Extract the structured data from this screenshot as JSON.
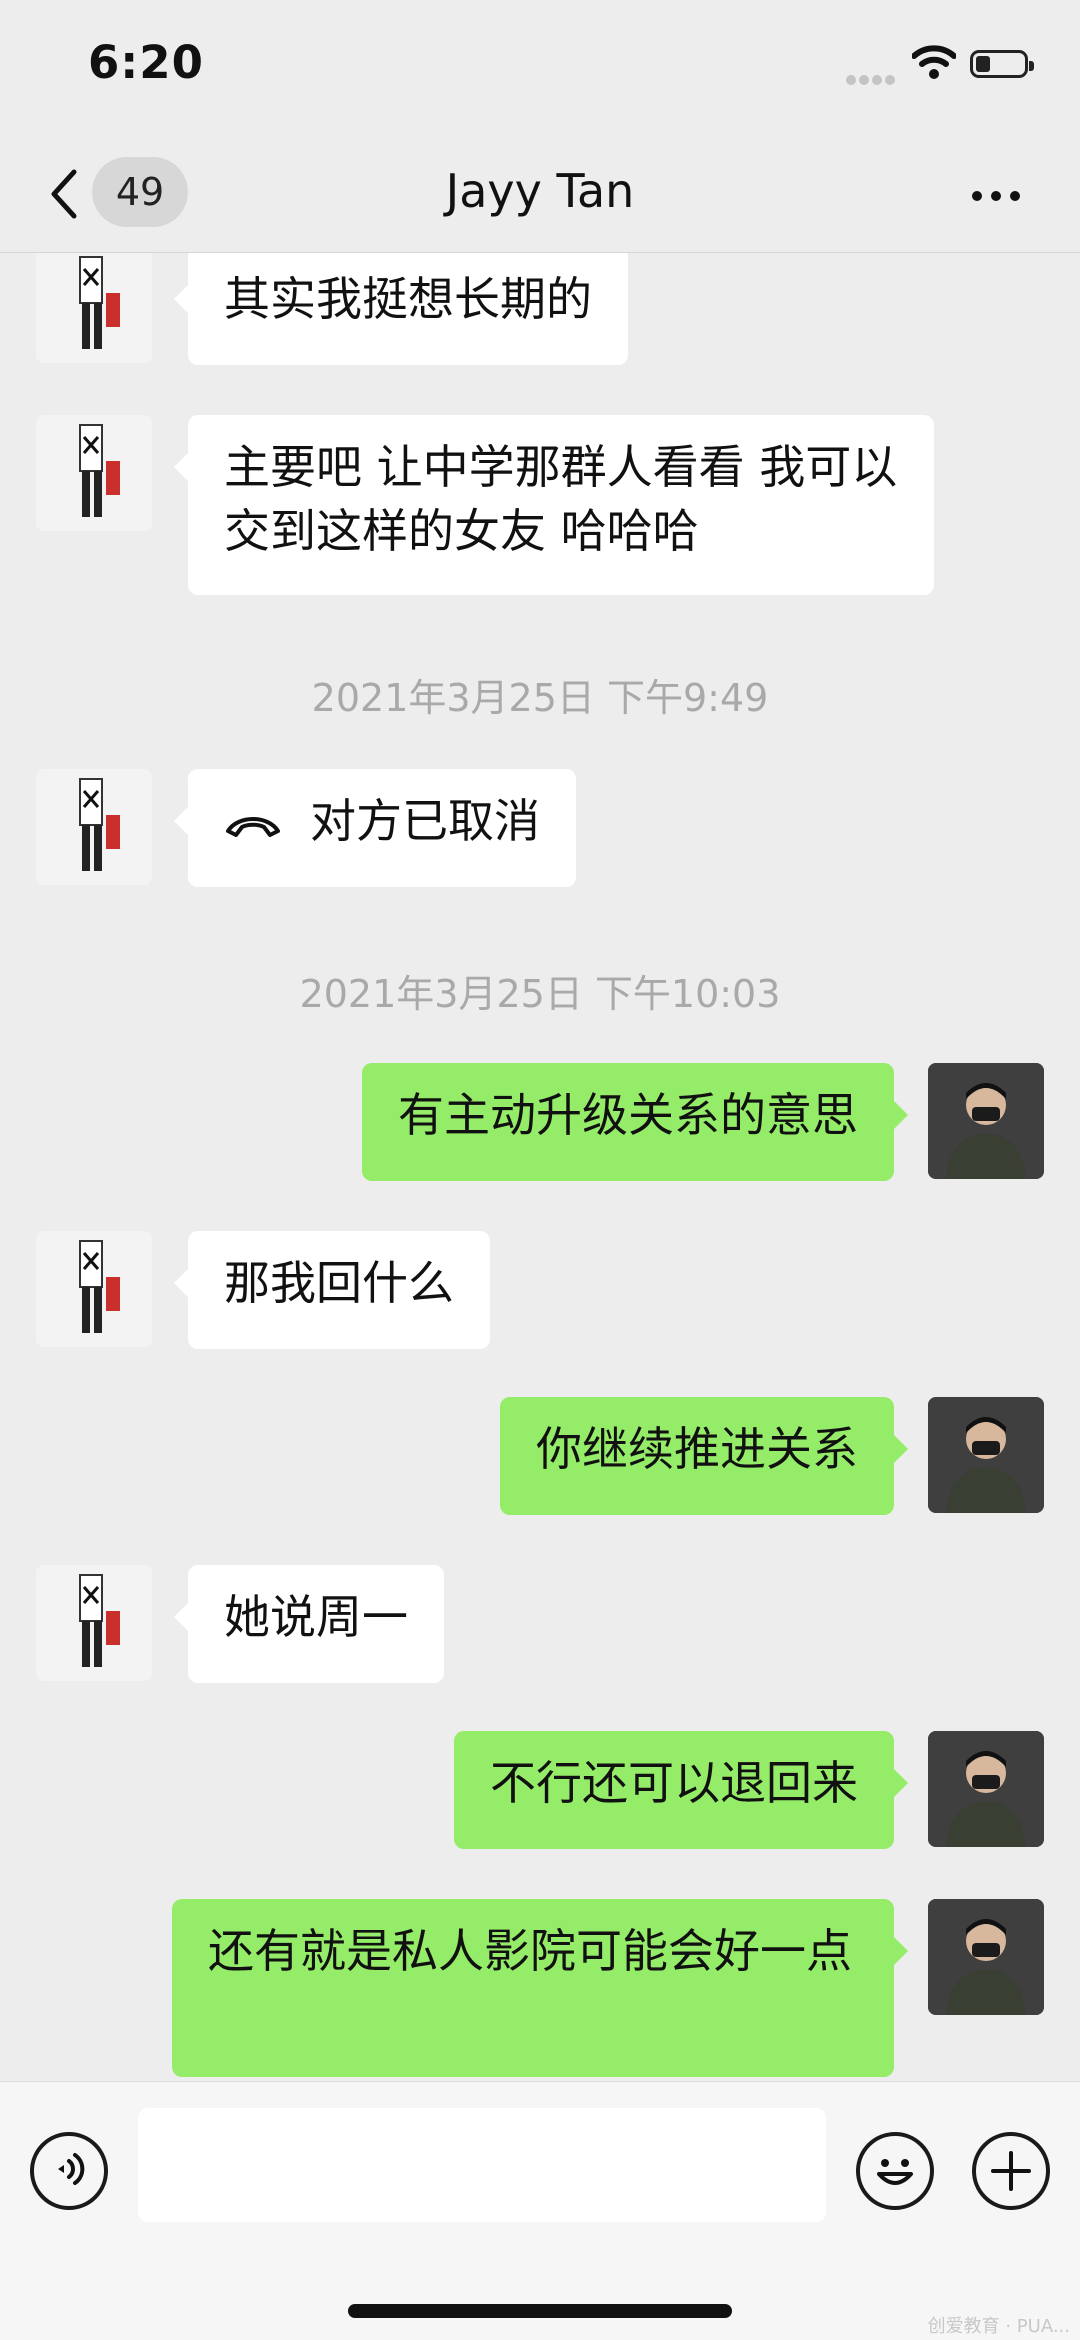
{
  "status_bar": {
    "time": "6:20"
  },
  "nav": {
    "unread_count": "49",
    "title": "Jayy Tan"
  },
  "messages": [
    {
      "from": "them",
      "text": "其实我挺想长期的"
    },
    {
      "from": "them",
      "text": "主要吧 让中学那群人看看 我可以交到这样的女友 哈哈哈"
    },
    {
      "timestamp": "2021年3月25日 下午9:49"
    },
    {
      "from": "them",
      "text": "对方已取消",
      "icon": "phone-hangup-icon"
    },
    {
      "timestamp": "2021年3月25日 下午10:03"
    },
    {
      "from": "me",
      "text": "有主动升级关系的意思"
    },
    {
      "from": "them",
      "text": "那我回什么"
    },
    {
      "from": "me",
      "text": "你继续推进关系"
    },
    {
      "from": "them",
      "text": "她说周一"
    },
    {
      "from": "me",
      "text": "不行还可以退回来"
    },
    {
      "from": "me",
      "text": "还有就是私人影院可能会好一点"
    }
  ],
  "input_bar": {
    "text_value": ""
  },
  "icons": {
    "back": "chevron-left-icon",
    "more": "more-dots-icon",
    "voice": "voice-icon",
    "emoji": "emoji-icon",
    "plus": "plus-icon"
  },
  "colors": {
    "my_bubble": "#95ec69",
    "their_bubble": "#ffffff",
    "background": "#ededed"
  },
  "watermark": "创爱教育 · PUA..."
}
